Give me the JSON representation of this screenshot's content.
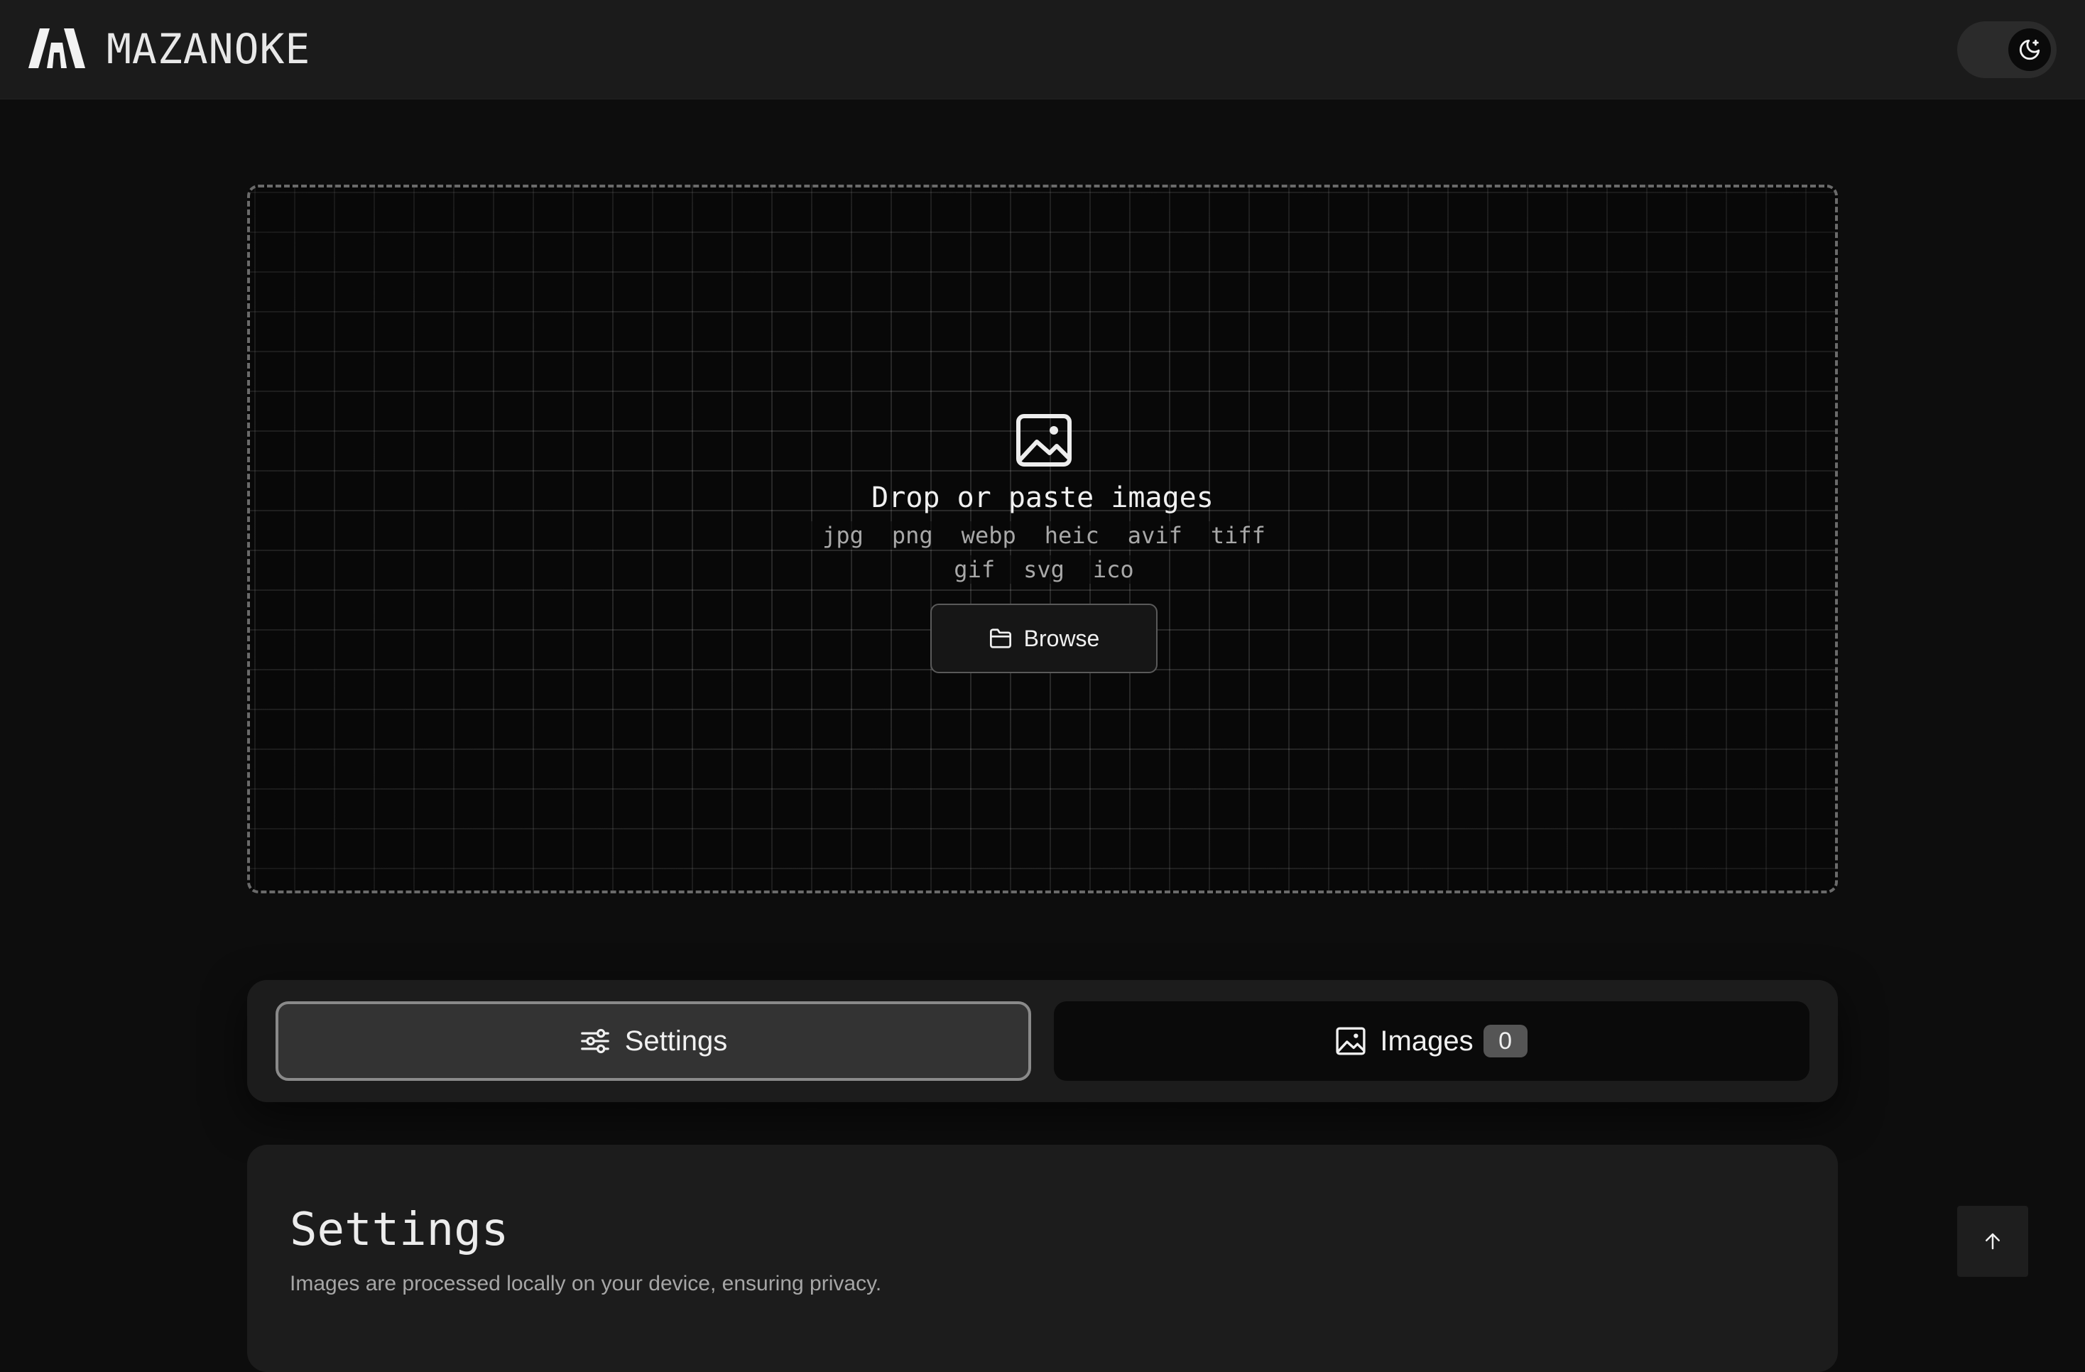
{
  "header": {
    "brand": "MAZANOKE",
    "logo_icon": "mazanoke-logo-icon",
    "theme_toggle_icon": "moon-icon"
  },
  "dropzone": {
    "icon": "image-icon",
    "title": "Drop or paste images",
    "formats": [
      "jpg",
      "png",
      "webp",
      "heic",
      "avif",
      "tiff",
      "gif",
      "svg",
      "ico"
    ],
    "browse_icon": "folder-icon",
    "browse_label": "Browse"
  },
  "tabs": {
    "settings": {
      "icon": "sliders-icon",
      "label": "Settings"
    },
    "images": {
      "icon": "image-icon",
      "label": "Images",
      "count": "0"
    }
  },
  "settings_panel": {
    "title": "Settings",
    "description": "Images are processed locally on your device, ensuring privacy."
  },
  "scroll_top_icon": "arrow-up-icon",
  "colors": {
    "background": "#0d0d0d",
    "header": "#1b1b1b",
    "panel": "#1c1c1c",
    "active_tab": "#333333",
    "badge": "#555555"
  }
}
